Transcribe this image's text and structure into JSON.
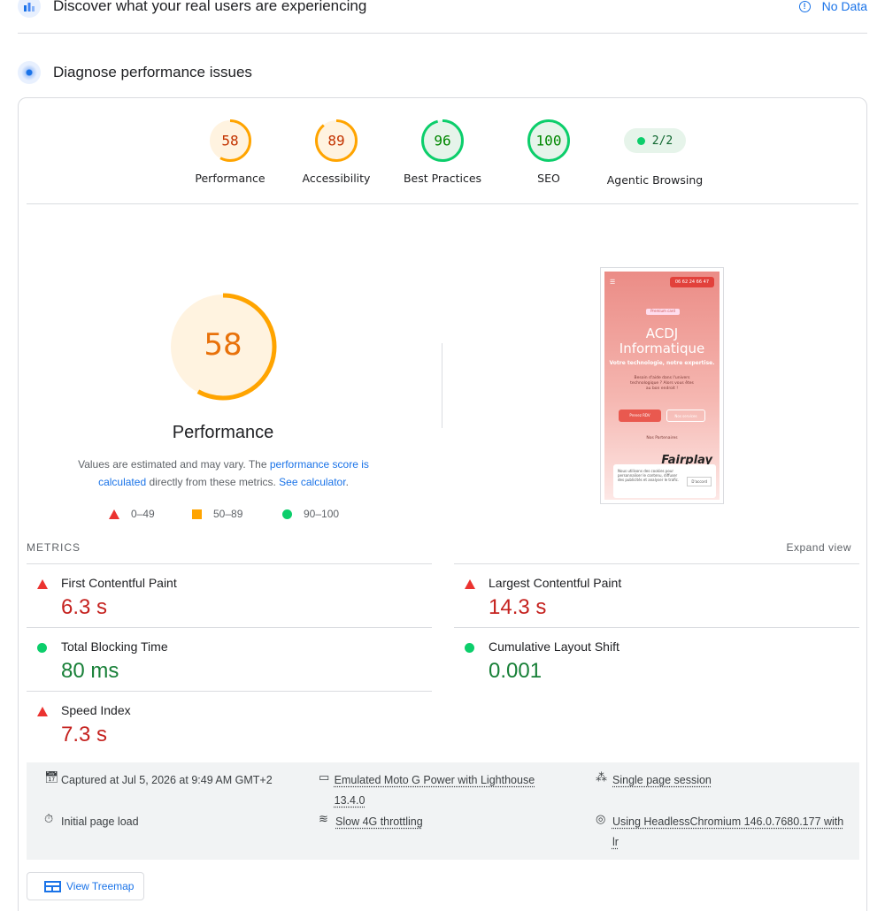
{
  "field_data": {
    "title": "Discover what your real users are experiencing",
    "status": "No Data",
    "status_icon": "info-icon"
  },
  "lab": {
    "title": "Diagnose performance issues",
    "icon": "lighthouse-icon"
  },
  "categories": [
    {
      "name": "Performance",
      "score": "58",
      "fraction": 0.58,
      "color": "#ffa400",
      "fill": "#fff3e0",
      "text_color": "#c33300"
    },
    {
      "name": "Accessibility",
      "score": "89",
      "fraction": 0.89,
      "color": "#ffa400",
      "fill": "#fff3e0",
      "text_color": "#c33300"
    },
    {
      "name": "Best Practices",
      "score": "96",
      "fraction": 0.96,
      "color": "#0cce6b",
      "fill": "#e6f4ea",
      "text_color": "#008800"
    },
    {
      "name": "SEO",
      "score": "100",
      "fraction": 1.0,
      "color": "#0cce6b",
      "fill": "#e6f4ea",
      "text_color": "#008800"
    }
  ],
  "agentic": {
    "name": "Agentic Browsing",
    "value": "2/2"
  },
  "performance": {
    "score": "58",
    "fraction": 0.58,
    "title": "Performance",
    "desc_prefix": "Values are estimated and may vary. The ",
    "desc_link1": "performance score is calculated",
    "desc_mid": " directly from these metrics. ",
    "desc_link2": "See calculator",
    "desc_suffix": "."
  },
  "legend": [
    {
      "shape": "triangle",
      "label": "0–49",
      "color": "#eb3330"
    },
    {
      "shape": "square",
      "label": "50–89",
      "color": "#ffa400"
    },
    {
      "shape": "circle",
      "label": "90–100",
      "color": "#0cce6b"
    }
  ],
  "screenshot": {
    "phone": "06 62 24 66 47",
    "chip": "Premium card",
    "heading_line1": "ACDJ",
    "heading_line2": "Informatique",
    "tagline": "Votre technologie, notre expertise.",
    "text": "Besoin d'aide dans l'univers technologique ? Alors vous êtes au bon endroit !",
    "button1": "Prenez RDV",
    "button2": "Nos services",
    "partners": "Nos Partenaires",
    "partner_logo": "Fairplay",
    "cookie_text": "Nous utilisons des cookies pour personnaliser le contenu, diffuser des publicités et analyser le trafic.",
    "cookie_button": "D'accord"
  },
  "metrics_header": {
    "title": "METRICS",
    "expand": "Expand view"
  },
  "metrics": [
    {
      "name": "First Contentful Paint",
      "value": "6.3 s",
      "rating": "bad"
    },
    {
      "name": "Largest Contentful Paint",
      "value": "14.3 s",
      "rating": "bad"
    },
    {
      "name": "Total Blocking Time",
      "value": "80 ms",
      "rating": "good"
    },
    {
      "name": "Cumulative Layout Shift",
      "value": "0.001",
      "rating": "good"
    },
    {
      "name": "Speed Index",
      "value": "7.3 s",
      "rating": "bad"
    }
  ],
  "env": {
    "captured": "Captured at Jul 5, 2026 at 9:49 AM GMT+2",
    "device": "Emulated Moto G Power with Lighthouse 13.4.0",
    "session": "Single page session",
    "load": "Initial page load",
    "throttling": "Slow 4G throttling",
    "browser": "Using HeadlessChromium 146.0.7680.177 with lr"
  },
  "treemap": {
    "label": "View Treemap"
  }
}
